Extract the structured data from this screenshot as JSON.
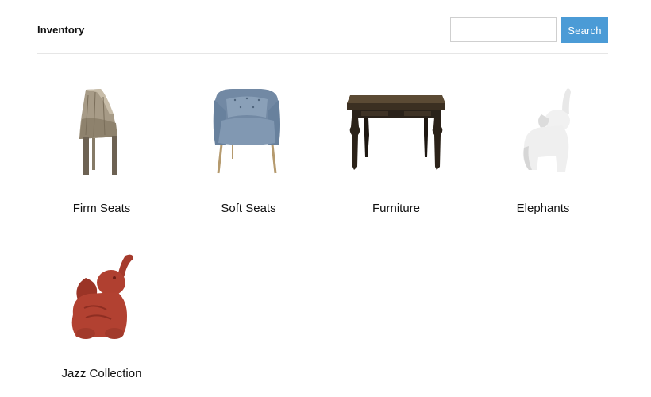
{
  "header": {
    "title": "Inventory",
    "search_placeholder": "",
    "search_button_label": "Search"
  },
  "colors": {
    "accent": "#4b9bd6",
    "divider": "#e6e6e6",
    "text": "#111111"
  },
  "categories": [
    {
      "label": "Firm Seats",
      "image": "wooden-stool-image"
    },
    {
      "label": "Soft Seats",
      "image": "blue-armchair-image"
    },
    {
      "label": "Furniture",
      "image": "wooden-table-image"
    },
    {
      "label": "Elephants",
      "image": "white-elephant-figurine-image"
    },
    {
      "label": "Jazz Collection",
      "image": "red-elephant-figurine-image"
    }
  ]
}
